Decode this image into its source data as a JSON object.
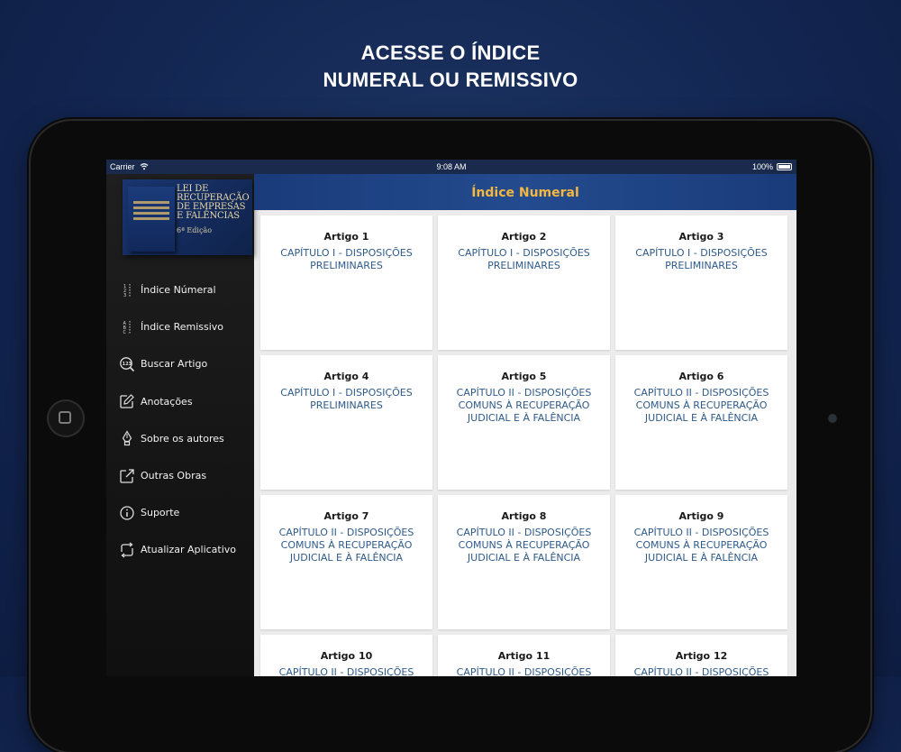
{
  "promo": {
    "line1": "ACESSE O ÍNDICE",
    "line2": "NUMERAL OU REMISSIVO"
  },
  "status_bar": {
    "carrier": "Carrier",
    "time": "9:08 AM",
    "battery": "100%"
  },
  "book_cover": {
    "title_lines": [
      "LEI DE",
      "RECUPERAÇÃO",
      "DE EMPRESAS",
      "E FALÊNCIAS"
    ],
    "edition": "6ª Edição"
  },
  "sidebar": {
    "items": [
      {
        "label": "Índice Númeral",
        "icon": "numbered-list-icon"
      },
      {
        "label": "Índice Remissivo",
        "icon": "alphabetical-list-icon"
      },
      {
        "label": "Buscar Artigo",
        "icon": "search-number-icon"
      },
      {
        "label": "Anotações",
        "icon": "edit-note-icon"
      },
      {
        "label": "Sobre os autores",
        "icon": "fountain-pen-icon"
      },
      {
        "label": "Outras Obras",
        "icon": "external-link-icon"
      },
      {
        "label": "Suporte",
        "icon": "info-icon"
      },
      {
        "label": "Atualizar Aplicativo",
        "icon": "sync-icon"
      }
    ]
  },
  "header": {
    "title": "Índice Numeral"
  },
  "articles": [
    {
      "title": "Artigo 1",
      "chapter": "CAPÍTULO I - DISPOSIÇÕES PRELIMINARES"
    },
    {
      "title": "Artigo 2",
      "chapter": "CAPÍTULO I - DISPOSIÇÕES PRELIMINARES"
    },
    {
      "title": "Artigo 3",
      "chapter": "CAPÍTULO I - DISPOSIÇÕES PRELIMINARES"
    },
    {
      "title": "Artigo 4",
      "chapter": "CAPÍTULO I - DISPOSIÇÕES PRELIMINARES"
    },
    {
      "title": "Artigo 5",
      "chapter": "CAPÍTULO II - DISPOSIÇÕES COMUNS À RECUPERAÇÃO JUDICIAL E À FALÊNCIA"
    },
    {
      "title": "Artigo 6",
      "chapter": "CAPÍTULO II - DISPOSIÇÕES COMUNS À RECUPERAÇÃO JUDICIAL E À FALÊNCIA"
    },
    {
      "title": "Artigo 7",
      "chapter": "CAPÍTULO II - DISPOSIÇÕES COMUNS À RECUPERAÇÃO JUDICIAL E À FALÊNCIA"
    },
    {
      "title": "Artigo 8",
      "chapter": "CAPÍTULO II - DISPOSIÇÕES COMUNS À RECUPERAÇÃO JUDICIAL E À FALÊNCIA"
    },
    {
      "title": "Artigo 9",
      "chapter": "CAPÍTULO II - DISPOSIÇÕES COMUNS À RECUPERAÇÃO JUDICIAL E À FALÊNCIA"
    },
    {
      "title": "Artigo 10",
      "chapter": "CAPÍTULO II - DISPOSIÇÕES"
    },
    {
      "title": "Artigo 11",
      "chapter": "CAPÍTULO II - DISPOSIÇÕES"
    },
    {
      "title": "Artigo 12",
      "chapter": "CAPÍTULO II - DISPOSIÇÕES"
    }
  ],
  "colors": {
    "background": "#132652",
    "header_bar": "#1f4585",
    "header_text": "#f4b740",
    "chapter_text": "#2e5a8a",
    "sidebar": "#1a1a1a"
  }
}
